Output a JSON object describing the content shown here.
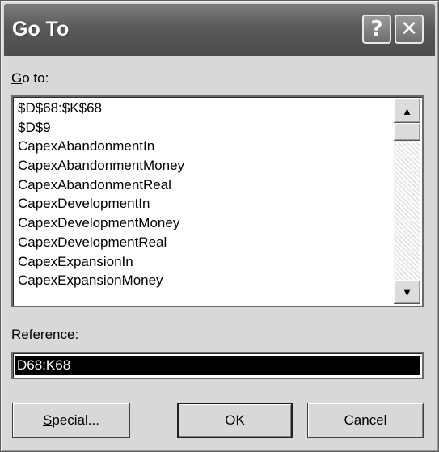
{
  "dialog": {
    "title": "Go To",
    "help_glyph": "?",
    "close_glyph": "✕"
  },
  "goto": {
    "label_accel": "G",
    "label_rest": "o to:",
    "items": [
      "$D$68:$K$68",
      "$D$9",
      "CapexAbandonmentIn",
      "CapexAbandonmentMoney",
      "CapexAbandonmentReal",
      "CapexDevelopmentIn",
      "CapexDevelopmentMoney",
      "CapexDevelopmentReal",
      "CapexExpansionIn",
      "CapexExpansionMoney"
    ]
  },
  "scrollbar": {
    "up_glyph": "▲",
    "down_glyph": "▼"
  },
  "reference": {
    "label_accel": "R",
    "label_rest": "eference:",
    "value": "D68:K68"
  },
  "buttons": {
    "special_accel": "S",
    "special_rest": "pecial...",
    "ok": "OK",
    "cancel": "Cancel"
  }
}
